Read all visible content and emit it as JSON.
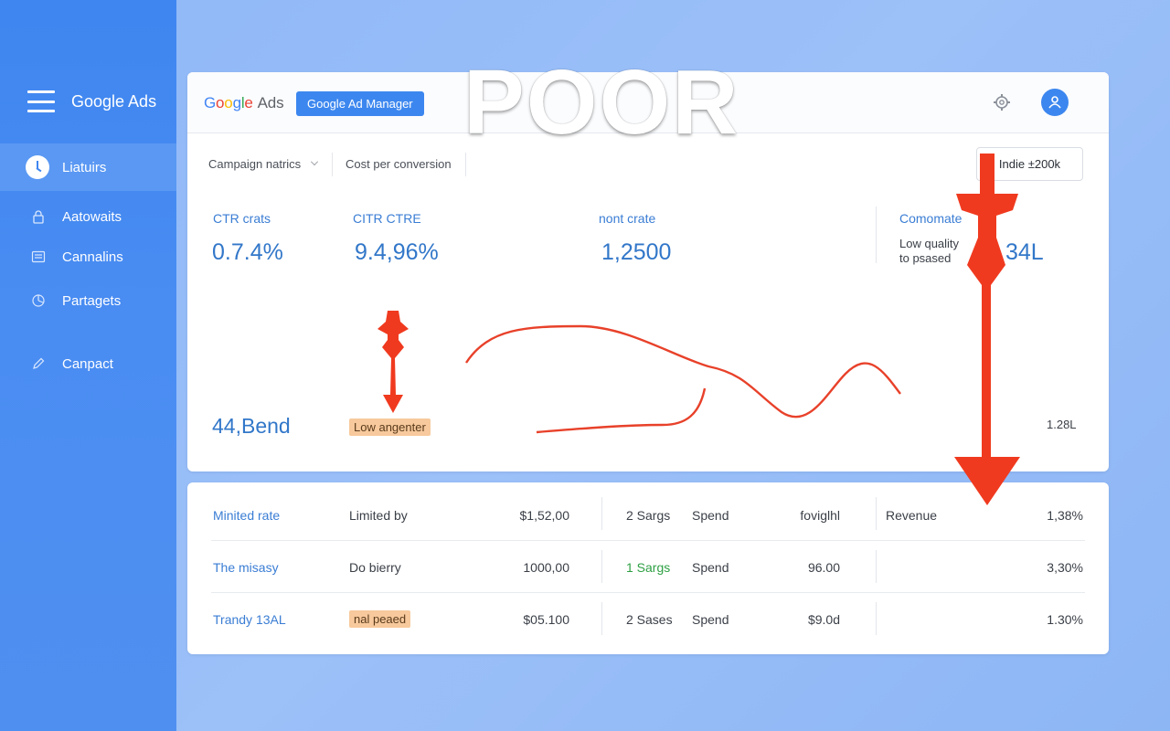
{
  "overlay": {
    "headline": "POOR"
  },
  "sidebar": {
    "brand": "Google Ads",
    "items": [
      {
        "label": "Liatuirs",
        "icon": "clock-icon"
      },
      {
        "label": "Aatowaits",
        "icon": "lock-icon"
      },
      {
        "label": "Cannalins",
        "icon": "list-icon"
      },
      {
        "label": "Partagets",
        "icon": "pie-icon"
      },
      {
        "label": "Canpact",
        "icon": "edit-icon"
      }
    ]
  },
  "header": {
    "logo_word": "Google",
    "logo_ads": "Ads",
    "manager_button": "Google Ad Manager"
  },
  "filters": {
    "campaign_metrics": "Campaign natrics",
    "cost_per_conversion": "Cost per conversion",
    "date_range": "Indie ±200k"
  },
  "metrics": [
    {
      "label": "CTR crats",
      "value": "0.7.4%"
    },
    {
      "label": "CITR CTRE",
      "value": "9.4,96%"
    },
    {
      "label": "nont crate",
      "value": "1,2500"
    },
    {
      "label": "Comomate",
      "value": "34L"
    }
  ],
  "quality_note": {
    "line1": "Low quality",
    "line2": "to psased"
  },
  "trend": {
    "left_value": "44,Bend",
    "badge": "Low angenter",
    "right_value": "1.28L"
  },
  "table": {
    "rows": [
      {
        "name": "Minited rate",
        "status": "Limited by",
        "amount": "$1,52,00",
        "sargs": "2 Sargs",
        "spend": "Spend",
        "metric": "foviglhl",
        "revenue": "Revenue",
        "pct": "1,38%"
      },
      {
        "name": "The misasy",
        "status": "Do bierry",
        "amount": "1000,00",
        "sargs": "1 Sargs",
        "spend": "Spend",
        "metric": "96.00",
        "revenue": "",
        "pct": "3,30%"
      },
      {
        "name": "Trandy 13AL",
        "status": "nal peaed",
        "amount": "$05.100",
        "sargs": "2 Sases",
        "spend": "Spend",
        "metric": "$9.0d",
        "revenue": "",
        "pct": "1.30%"
      }
    ]
  },
  "colors": {
    "sidebar": "#3f86f0",
    "accent_blue": "#3c87ef",
    "warning_red": "#f03a1f",
    "badge_orange": "#f7c99c"
  }
}
